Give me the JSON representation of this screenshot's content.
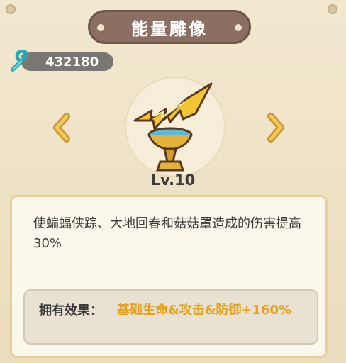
{
  "window": {
    "title": "能量雕像"
  },
  "resource": {
    "value": "432180",
    "icon": "wrench-icon"
  },
  "statue": {
    "icon": "lightning-statue-icon",
    "level_label": "Lv.10"
  },
  "navigation": {
    "prev_icon": "chevron-left-icon",
    "next_icon": "chevron-right-icon"
  },
  "panel": {
    "description": "使蝙蝠侠踪、大地回春和菇菇罩造成的伤害提高30%",
    "effect_label": "拥有效果：",
    "effect_value": "基础生命&攻击&防御+160%"
  },
  "colors": {
    "accent": "#e3a11e",
    "title_plate": "#8a6f62",
    "background": "#efe4c9"
  }
}
